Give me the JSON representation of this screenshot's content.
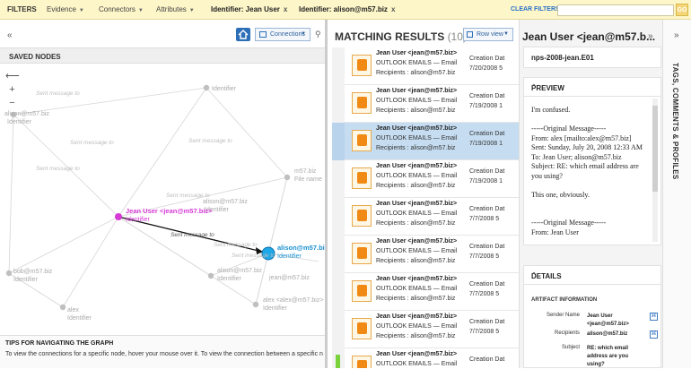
{
  "topbar": {
    "filters_label": "FILTERS",
    "menus": [
      {
        "label": "Evidence"
      },
      {
        "label": "Connectors"
      },
      {
        "label": "Attributes"
      }
    ],
    "chips": [
      {
        "label": "Identifier: Jean User"
      },
      {
        "label": "Identifier: alison@m57.biz"
      }
    ],
    "chip_remove": "x",
    "clear_label": "CLEAR FILTERS",
    "search_value": "",
    "go_label": "GO"
  },
  "graph_panel": {
    "collapse_icon": "«",
    "connections_label": "Connections",
    "saved_nodes_label": "SAVED NODES",
    "zoom": {
      "back": "⟵",
      "in": "+",
      "out": "−"
    },
    "nodes": [
      {
        "label": "Identifier",
        "sub": ""
      },
      {
        "label": "alison@m57.biz",
        "sub": "Identifier"
      },
      {
        "label": "m57.biz",
        "sub": "File name"
      },
      {
        "label": "Jean User <jean@m57.biz>",
        "sub": "Identifier"
      },
      {
        "label": "alison@m57.biz",
        "sub": "Identifier"
      },
      {
        "label": "bob@m57.biz",
        "sub": "Identifier"
      },
      {
        "label": "alison@m57.biz",
        "sub": "Identifier"
      },
      {
        "label": "alex <alex@m57.biz>",
        "sub": "Identifier"
      },
      {
        "label": "alex",
        "sub": "Identifier"
      },
      {
        "label": "jean@m57.biz",
        "sub": "Identifier"
      }
    ],
    "edge_labels": [
      "Sent message to",
      "Sent message to",
      "Sent message to",
      "Sent message to",
      "Sent message to",
      "Sent message to",
      "Sent message to",
      "Sent message to"
    ],
    "tips_title": "TIPS FOR NAVIGATING THE GRAPH",
    "tips_text": "To view the connections for a specific node, hover your mouse over it. To view the connection between a specific node and the primary node, click it. To make a node the primary node, double click it. To save a node to the graph, click and hold it."
  },
  "results": {
    "title": "MATCHING RESULTS",
    "count": "(10)",
    "row_view_label": "Row view",
    "rows": [
      {
        "from": "Jean User <jean@m57.biz>",
        "type": "OUTLOOK EMAILS — Email",
        "recipients": "Recipients : alison@m57.biz",
        "col": "Creation Dat",
        "date": "7/20/2008 5",
        "selected": false
      },
      {
        "from": "Jean User <jean@m57.biz>",
        "type": "OUTLOOK EMAILS — Email",
        "recipients": "Recipients : alison@m57.biz",
        "col": "Creation Dat",
        "date": "7/19/2008 1",
        "selected": false
      },
      {
        "from": "Jean User <jean@m57.biz>",
        "type": "OUTLOOK EMAILS — Email",
        "recipients": "Recipients : alison@m57.biz",
        "col": "Creation Dat",
        "date": "7/19/2008 1",
        "selected": true
      },
      {
        "from": "Jean User <jean@m57.biz>",
        "type": "OUTLOOK EMAILS — Email",
        "recipients": "Recipients : alison@m57.biz",
        "col": "Creation Dat",
        "date": "7/19/2008 1",
        "selected": false
      },
      {
        "from": "Jean User <jean@m57.biz>",
        "type": "OUTLOOK EMAILS — Email",
        "recipients": "Recipients : alison@m57.biz",
        "col": "Creation Dat",
        "date": "7/7/2008 5",
        "selected": false
      },
      {
        "from": "Jean User <jean@m57.biz>",
        "type": "OUTLOOK EMAILS — Email",
        "recipients": "Recipients : alison@m57.biz",
        "col": "Creation Dat",
        "date": "7/7/2008 5",
        "selected": false
      },
      {
        "from": "Jean User <jean@m57.biz>",
        "type": "OUTLOOK EMAILS — Email",
        "recipients": "Recipients : alison@m57.biz",
        "col": "Creation Dat",
        "date": "7/7/2008 5",
        "selected": false
      },
      {
        "from": "Jean User <jean@m57.biz>",
        "type": "OUTLOOK EMAILS — Email",
        "recipients": "Recipients : alison@m57.biz",
        "col": "Creation Dat",
        "date": "7/7/2008 5",
        "selected": false
      },
      {
        "from": "Jean User <jean@m57.biz>",
        "type": "OUTLOOK EMAILS — Email",
        "recipients": "",
        "col": "Creation Dat",
        "date": "",
        "selected": false
      }
    ]
  },
  "detail": {
    "title": "Jean User <jean@m57.b...",
    "close_icon": "»",
    "artifact_id": "nps-2008-jean.E01",
    "preview_label": "PREVIEW",
    "preview_text": "I'm confused.\n\n-----Original Message-----\nFrom: alex [mailto:alex@m57.biz]\nSent: Sunday, July 20, 2008 12:33 AM\nTo: Jean User; alison@m57.biz\nSubject: RE: which email address are you using?\n\nThis one, obviously.\n\n\n-----Original Message-----\nFrom: Jean User",
    "details_label": "DETAILS",
    "artifact_info_label": "ARTIFACT INFORMATION",
    "fields": [
      {
        "key": "Sender Name",
        "value": "Jean User <jean@m57.biz>"
      },
      {
        "key": "Recipients",
        "value": "alison@m57.biz"
      },
      {
        "key": "Subject",
        "value": "RE: which email address are you using?"
      }
    ]
  },
  "side_tab": {
    "label": "TAGS, COMMENTS & PROFILES",
    "expand_icon": "»"
  },
  "colors": {
    "primary_node": "#d63ad6",
    "selected_node": "#1ea8e8",
    "accent": "#2d6fb7",
    "selected_row": "#c6ddf1"
  }
}
